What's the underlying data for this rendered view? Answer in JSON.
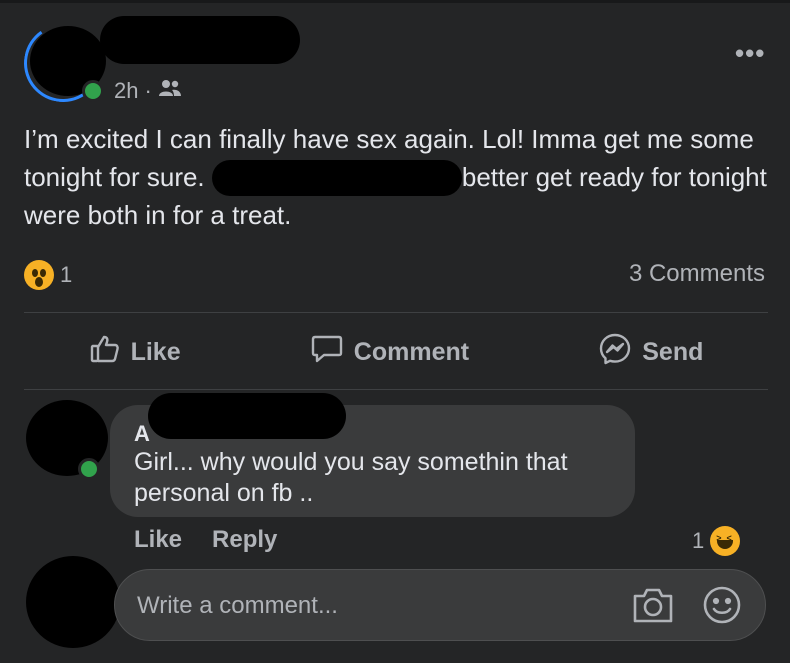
{
  "post": {
    "meta_time": "2h",
    "meta_dot": "·",
    "more_label": "•••",
    "text_part1": "I’m excited I can finally have sex again. Lol! Imma get me some tonight for sure. ",
    "text_part2": "better get ready for tonight were both in for a treat.",
    "reaction_count": "1",
    "comments_count": "3 Comments"
  },
  "actions": {
    "like": "Like",
    "comment": "Comment",
    "send": "Send"
  },
  "comment": {
    "author_initial": "A",
    "text": "Girl... why would you say somethin that personal on fb ..",
    "like": "Like",
    "reply": "Reply",
    "reaction_count": "1"
  },
  "composer": {
    "placeholder": "Write a comment..."
  },
  "colors": {
    "background": "#242526",
    "text": "#e4e6eb",
    "muted": "#b0b3b8",
    "accent": "#2d88ff",
    "online": "#31a24c",
    "bubble": "#3a3b3c"
  },
  "icons": {
    "audience": "friends-icon",
    "reaction_post": "wow-reaction-icon",
    "reaction_comment": "haha-reaction-icon",
    "like": "thumbs-up-icon",
    "comment": "speech-bubble-icon",
    "send": "messenger-icon",
    "camera": "camera-icon",
    "emoji": "smiley-icon"
  }
}
